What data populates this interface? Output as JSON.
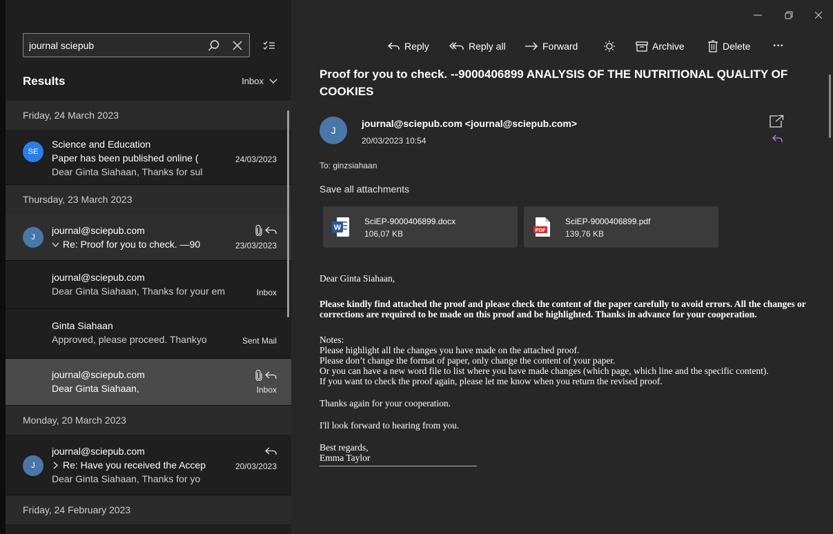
{
  "search": {
    "query": "journal sciepub",
    "placeholder": "Search"
  },
  "results": {
    "title": "Results",
    "folder": "Inbox"
  },
  "groups": [
    {
      "date": "Friday, 24 March 2023",
      "messages": [
        {
          "avatar": "SE",
          "sender": "Science and Education",
          "subject": "Paper has been published online (",
          "date": "24/03/2023",
          "preview": "Dear Ginta Siahaan, Thanks for sul"
        }
      ]
    },
    {
      "date": "Thursday, 23 March 2023",
      "messages": [
        {
          "avatar": "J",
          "sender": "journal@sciepub.com",
          "subject": "Re: Proof for you to check. —90",
          "date": "23/03/2023"
        },
        {
          "sender": "journal@sciepub.com",
          "preview": "Dear Ginta Siahaan, Thanks for your em",
          "folder": "Inbox"
        },
        {
          "sender": "Ginta Siahaan",
          "preview": "Approved, please proceed. Thankyo",
          "folder": "Sent Mail"
        },
        {
          "sender": "journal@sciepub.com",
          "preview": "Dear Ginta Siahaan,",
          "folder": "Inbox"
        }
      ]
    },
    {
      "date": "Monday, 20 March 2023",
      "messages": [
        {
          "avatar": "J",
          "sender": "journal@sciepub.com",
          "subject": "Re: Have you received the Accep",
          "date": "20/03/2023",
          "preview": "Dear Ginta Siahaan, Thanks for yo"
        }
      ]
    },
    {
      "date": "Friday, 24 February 2023",
      "messages": []
    }
  ],
  "toolbar": {
    "reply": "Reply",
    "reply_all": "Reply all",
    "forward": "Forward",
    "archive": "Archive",
    "delete": "Delete",
    "more": "···"
  },
  "email": {
    "subject": "Proof for you to check. --9000406899 ANALYSIS OF THE NUTRITIONAL QUALITY OF COOKIES",
    "avatar": "J",
    "from": "journal@sciepub.com <journal@sciepub.com>",
    "date": "20/03/2023 10:54",
    "to": "To: ginzsiahaan",
    "save_all": "Save all attachments",
    "attachments": [
      {
        "name": "SciEP-9000406899.docx",
        "size": "106,07 KB",
        "type": "word-doc-icon"
      },
      {
        "name": "SciEP-9000406899.pdf",
        "size": "139,76 KB",
        "type": "pdf-icon"
      }
    ],
    "body": {
      "greeting": "Dear Ginta Siahaan,",
      "bold_para": "Please kindly find attached the proof and please check the content of the paper carefully to avoid errors. All the changes or corrections are required to be made on this proof and be highlighted. Thanks in advance for your cooperation.",
      "notes_title": "Notes:",
      "note1": "Please highlight all the changes you have made on the attached proof.",
      "note2": "Please don’t change the format of paper, only change the content of your paper.",
      "note3": "Or you can have a new word file to list where you have made changes (which page, which line and the specific content).",
      "note4": "If you want to check the proof again, please let me know when you return the revised proof.",
      "thanks": "Thanks again for your cooperation.",
      "forward": "I'll look forward to hearing from you.",
      "regards": "Best regards,",
      "name": "Emma Taylor"
    }
  },
  "colors": {
    "accent_reply": "#c77dff",
    "avatar_se": "#2b7de9",
    "avatar_j": "#4a76a8"
  }
}
